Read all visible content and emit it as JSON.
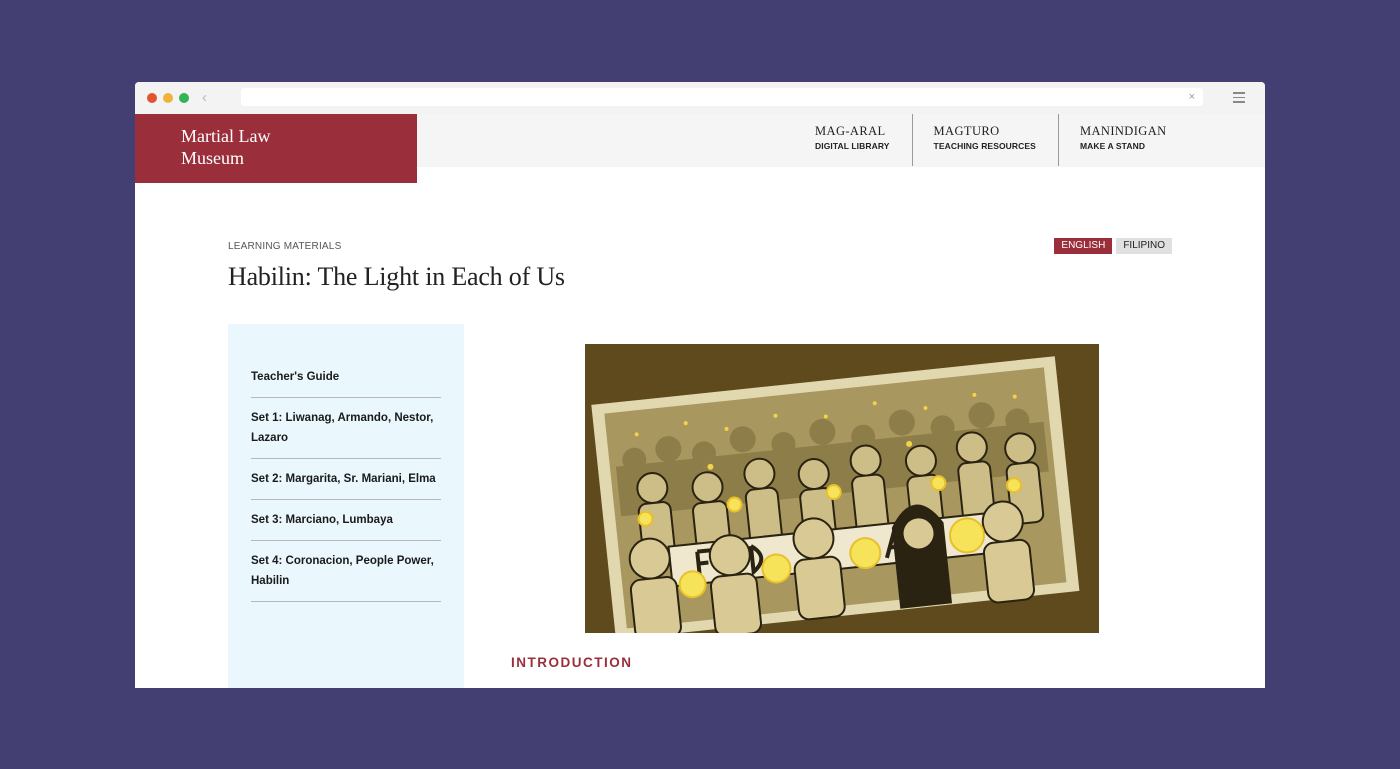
{
  "site": {
    "logo_line1": "Martial Law",
    "logo_line2": "Museum"
  },
  "nav": [
    {
      "title": "MAG-ARAL",
      "subtitle": "DIGITAL LIBRARY"
    },
    {
      "title": "MAGTURO",
      "subtitle": "TEACHING RESOURCES"
    },
    {
      "title": "MANINDIGAN",
      "subtitle": "MAKE A STAND"
    }
  ],
  "page": {
    "eyebrow": "LEARNING MATERIALS",
    "title": "Habilin: The Light in Each of Us",
    "lang_active": "ENGLISH",
    "lang_other": "FILIPINO",
    "section_heading": "INTRODUCTION"
  },
  "sidebar": {
    "items": [
      {
        "label": "Teacher's Guide"
      },
      {
        "label": "Set 1: Liwanag, Armando, Nestor, Lazaro"
      },
      {
        "label": "Set 2: Margarita, Sr. Mariani, Elma"
      },
      {
        "label": "Set 3: Marciano, Lumbaya"
      },
      {
        "label": "Set 4: Coronacion, People Power, Habilin"
      }
    ]
  },
  "colors": {
    "brand": "#9a2f3b",
    "page_bg": "#443f72",
    "sidebar_bg": "#eaf7fd",
    "illustration_bg": "#5e4a1c"
  }
}
